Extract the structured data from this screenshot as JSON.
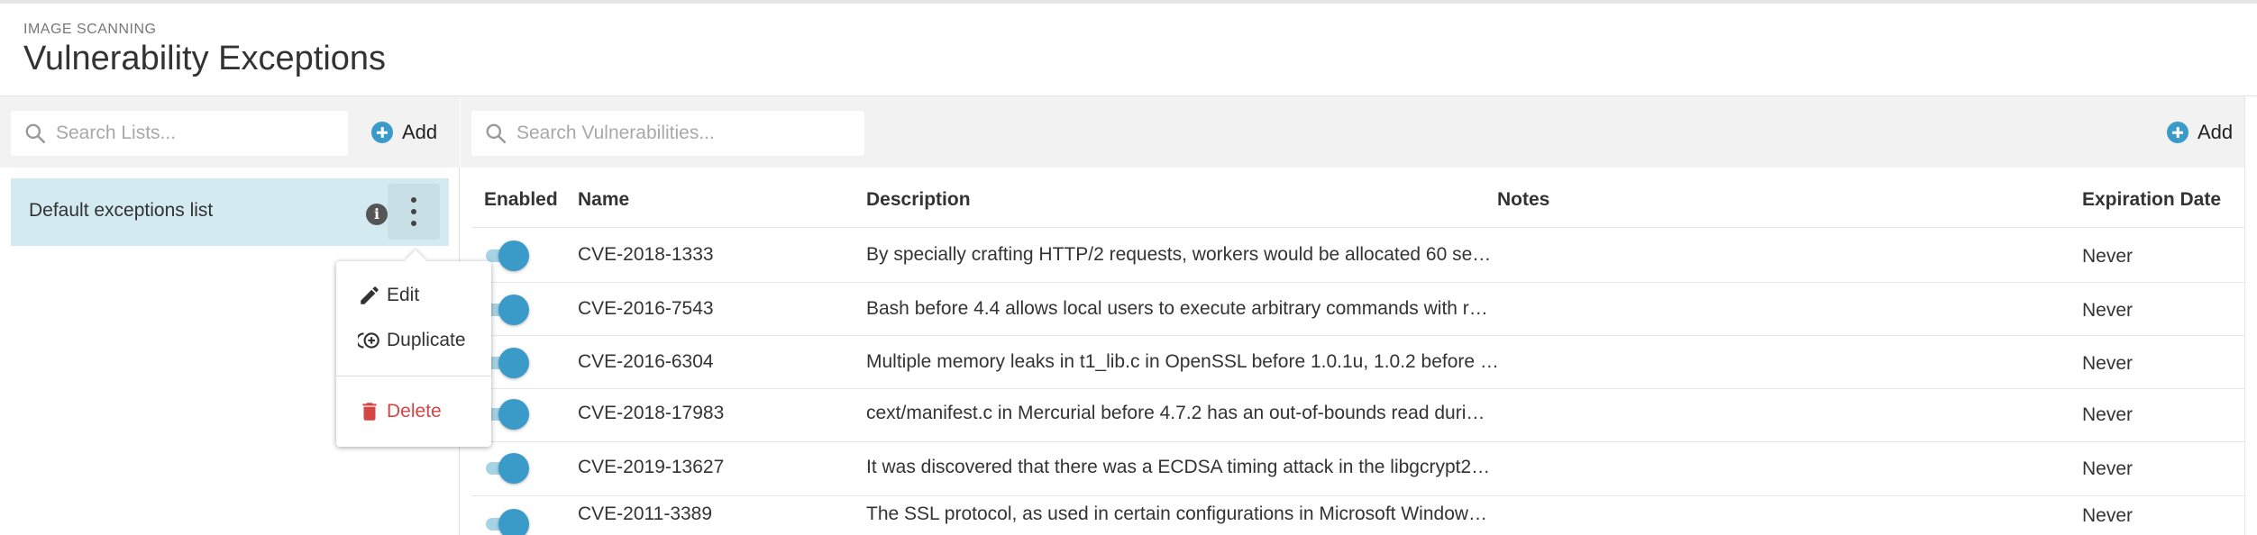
{
  "header": {
    "section": "IMAGE SCANNING",
    "title": "Vulnerability Exceptions"
  },
  "lists_panel": {
    "search_placeholder": "Search Lists...",
    "add_label": "Add",
    "items": [
      {
        "name": "Default exceptions list"
      }
    ]
  },
  "context_menu": {
    "edit": "Edit",
    "duplicate": "Duplicate",
    "delete": "Delete"
  },
  "vulns_panel": {
    "search_placeholder": "Search Vulnerabilities...",
    "add_label": "Add",
    "columns": {
      "enabled": "Enabled",
      "name": "Name",
      "description": "Description",
      "notes": "Notes",
      "expiration": "Expiration Date"
    },
    "rows": [
      {
        "enabled": true,
        "name": "CVE-2018-1333",
        "description": "By specially crafting HTTP/2 requests, workers would be allocated 60 se…",
        "notes": "",
        "expiration": "Never"
      },
      {
        "enabled": true,
        "name": "CVE-2016-7543",
        "description": "Bash before 4.4 allows local users to execute arbitrary commands with r…",
        "notes": "",
        "expiration": "Never"
      },
      {
        "enabled": true,
        "name": "CVE-2016-6304",
        "description": "Multiple memory leaks in t1_lib.c in OpenSSL before 1.0.1u, 1.0.2 before …",
        "notes": "",
        "expiration": "Never"
      },
      {
        "enabled": true,
        "name": "CVE-2018-17983",
        "description": "cext/manifest.c in Mercurial before 4.7.2 has an out-of-bounds read duri…",
        "notes": "",
        "expiration": "Never"
      },
      {
        "enabled": true,
        "name": "CVE-2019-13627",
        "description": "It was discovered that there was a ECDSA timing attack in the libgcrypt2…",
        "notes": "",
        "expiration": "Never"
      },
      {
        "enabled": true,
        "name": "CVE-2011-3389",
        "description": "The SSL protocol, as used in certain configurations in Microsoft Window…",
        "notes": "",
        "expiration": "Never"
      }
    ]
  },
  "colors": {
    "accent": "#3a9bc9",
    "selected_row": "#d3eaf1",
    "delete_text": "#d64545",
    "toolbar_bg": "#f2f2f2"
  },
  "icons": [
    "search-icon",
    "plus-icon",
    "info-icon",
    "kebab-icon",
    "pencil-icon",
    "duplicate-icon",
    "trash-icon"
  ]
}
